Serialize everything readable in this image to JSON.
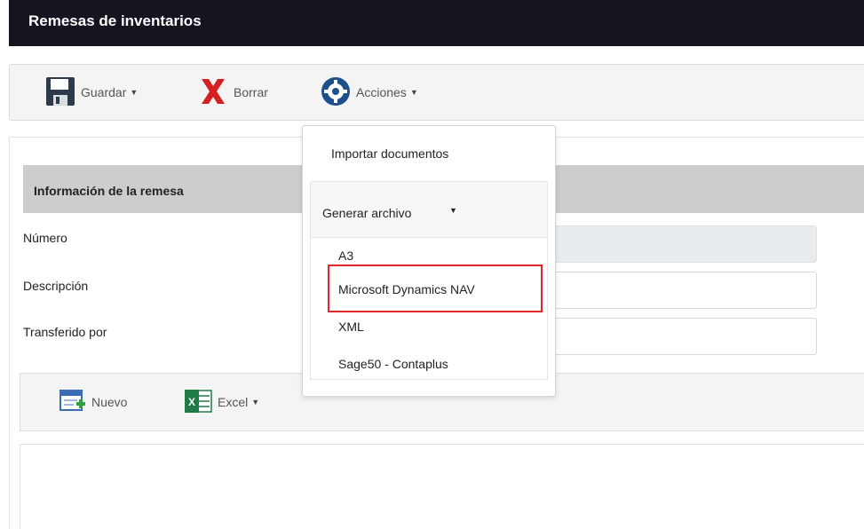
{
  "window": {
    "title": "Remesas de inventarios"
  },
  "toolbar": {
    "save_label": "Guardar",
    "delete_label": "Borrar",
    "actions_label": "Acciones"
  },
  "actions_menu": {
    "import_label": "Importar documentos",
    "generate_label": "Generar archivo",
    "generate_options": [
      "A3",
      "Microsoft Dynamics NAV",
      "XML",
      "Sage50 - Contaplus"
    ],
    "highlighted_option": "Microsoft Dynamics NAV"
  },
  "section": {
    "title": "Información de la remesa",
    "fields": [
      {
        "label": "Número",
        "value": ""
      },
      {
        "label": "Descripción",
        "value": ""
      },
      {
        "label": "Transferido por",
        "value": ""
      }
    ]
  },
  "grid_toolbar": {
    "new_label": "Nuevo",
    "excel_label": "Excel"
  },
  "colors": {
    "title_bar": "#15151f",
    "highlight_border": "#e2262b",
    "section_header": "#cdcdcd"
  }
}
